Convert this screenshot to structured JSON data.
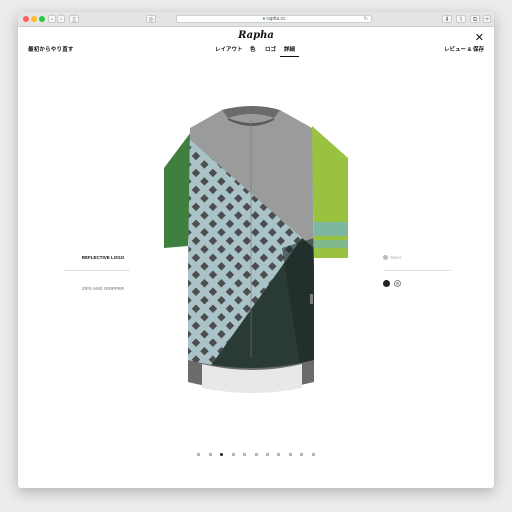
{
  "browser": {
    "url": "rapha.cc",
    "colors": {
      "close": "#ff5f57",
      "minimize": "#febc2e",
      "zoom": "#28c840"
    }
  },
  "header": {
    "start_over": "最初からやり直す",
    "logo": "Rapha",
    "review_save": "レビュー & 保存",
    "tabs": [
      {
        "label": "レイアウト",
        "active": false
      },
      {
        "label": "色",
        "active": false
      },
      {
        "label": "ロゴ",
        "active": false
      },
      {
        "label": "詳細",
        "active": true
      }
    ],
    "close_icon": "close-icon"
  },
  "options_left": [
    {
      "label": "REFLECTIVE LOGO",
      "active": true
    },
    {
      "label": "ZIPS AND GRIPPER",
      "active": false
    }
  ],
  "options_right": {
    "selected_label": "Silver",
    "swatches": [
      {
        "name": "black",
        "color": "#222222"
      },
      {
        "name": "silver",
        "color": "#a9a9a9"
      }
    ]
  },
  "carousel": {
    "total": 11,
    "active_index": 2
  },
  "jersey_colors": {
    "body_gray": "#9a9c9b",
    "sleeve_green": "#98c23f",
    "sleeve_dark_green": "#3f7f3f",
    "stripe_teal": "#7db7a0",
    "pattern_light": "#a9c3c9",
    "pattern_dark": "#4b4d4f",
    "panel_dark": "#2a3b35",
    "trim": "#6a6b6a"
  }
}
